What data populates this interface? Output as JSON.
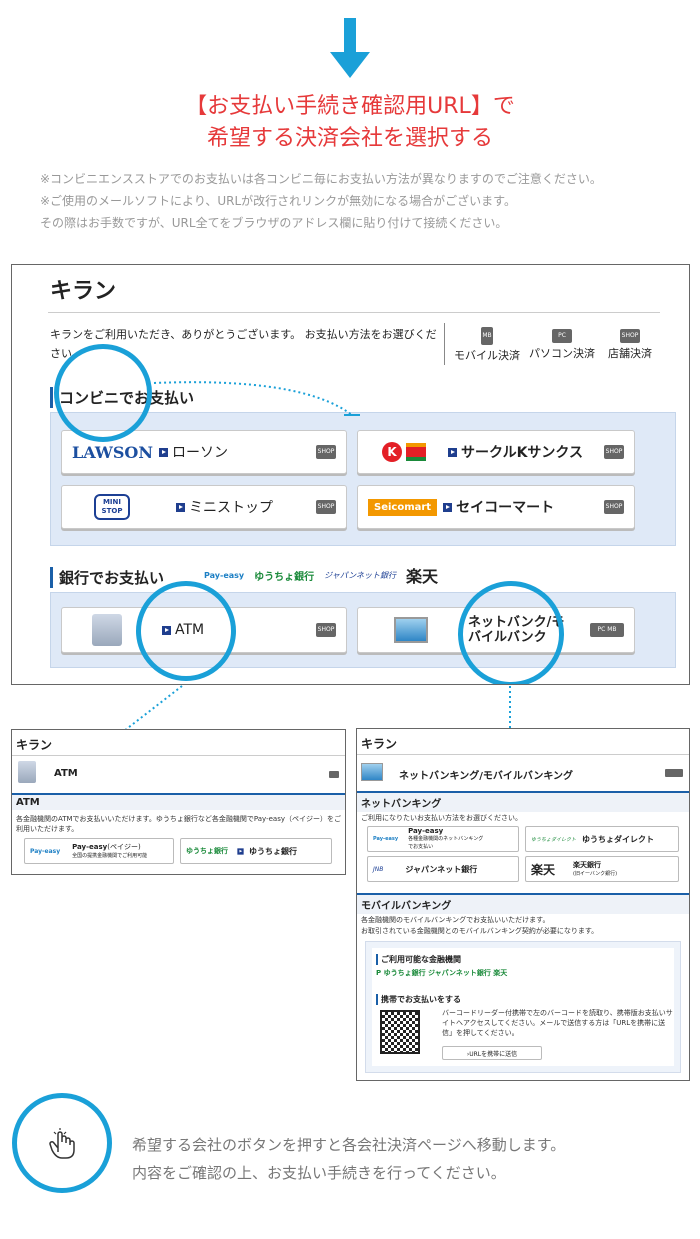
{
  "headline": {
    "line1": "【お支払い手続き確認用URL】で",
    "line2": "希望する決済会社を選択する"
  },
  "notes": [
    "※コンビニエンスストアでのお支払いは各コンビニ毎にお支払い方法が異なりますのでご注意ください。",
    "※ご使用のメールソフトにより、URLが改行されリンクが無効になる場合がございます。",
    "その際はお手数ですが、URL全てをブラウザのアドレス欄に貼り付けて接続ください。"
  ],
  "main": {
    "title": "キラン",
    "intro": "キランをご利用いただき、ありがとうございます。 お支払い方法をお選びください。",
    "modes": [
      {
        "label": "モバイル決済",
        "icon": "MB"
      },
      {
        "label": "パソコン決済",
        "icon": "PC"
      },
      {
        "label": "店舗決済",
        "icon": "SHOP"
      }
    ],
    "conv_title": "コンビニでお支払い",
    "conv": [
      {
        "logo": "LAWSON",
        "label": "ローソン"
      },
      {
        "logo": "K",
        "label": "サークルKサンクス"
      },
      {
        "logo": "MINI STOP",
        "label": "ミニストップ"
      },
      {
        "logo": "Seicomart",
        "label": "セイコーマート"
      }
    ],
    "bank_title": "銀行でお支払い",
    "bank_logos": [
      "Pay-easy",
      "ゆうちょ銀行",
      "ジャパンネット銀行",
      "楽天"
    ],
    "atm_label": "ATM",
    "net_label": "ネットバンク/モバイルバンク",
    "shop": "SHOP"
  },
  "atm_window": {
    "title": "キラン",
    "heading": "ATM",
    "section": "ATM",
    "desc": "各金融機関のATMでお支払いいただけます。ゆうちょ銀行など各金融機関でPay-easy（ペイジー）をご利用いただけます。",
    "payeasy": "Pay-easy",
    "payeasy_sub": "(ペイジー)",
    "payeasy_desc": "全国の提携金融機関でご利用可能",
    "yucho": "ゆうちょ銀行"
  },
  "net_window": {
    "title": "キラン",
    "heading": "ネットバンキング/モバイルバンキング",
    "sec1": "ネットバンキング",
    "desc1": "ご利用になりたいお支払い方法をお選びください。",
    "items": [
      {
        "logo": "Pay-easy",
        "label": "Pay-easy",
        "sub": "各種金融機関のネットバンキングでお支払い"
      },
      {
        "logo": "ゆうちょダイレクト",
        "label": "ゆうちょダイレクト"
      },
      {
        "logo": "JNB",
        "label": "ジャパンネット銀行"
      },
      {
        "logo": "楽天",
        "label": "楽天銀行",
        "sub": "(旧イーバンク銀行)"
      }
    ],
    "sec2": "モバイルバンキング",
    "desc2a": "各金融機関のモバイルバンキングでお支払いいただけます。",
    "desc2b": "お取引されている金融機関とのモバイルバンキング契約が必要になります。",
    "avail": "ご利用可能な金融機関",
    "mobile": "携帯でお支払いをする",
    "mobile_desc": "バーコードリーダー付携帯で左のバーコードを読取り、携帯版お支払いサイトへアクセスしてください。メールで送信する方は「URLを携帯に送信」を押してください。",
    "send_btn": "›URLを携帯に送信"
  },
  "footer": {
    "line1": "希望する会社のボタンを押すと各会社決済ページへ移動します。",
    "line2": "内容をご確認の上、お支払い手続きを行ってください。"
  }
}
